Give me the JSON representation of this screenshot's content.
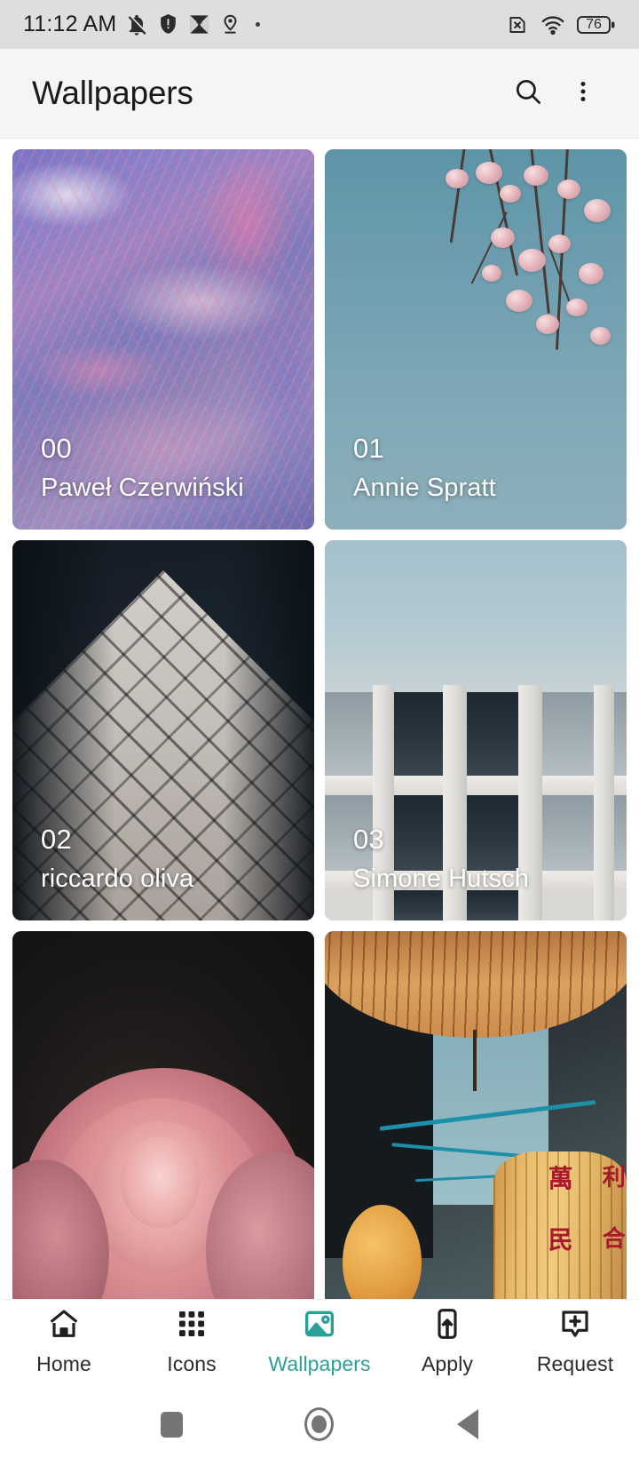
{
  "status_bar": {
    "time": "11:12 AM",
    "battery_percent": "76",
    "left_icons": [
      "notifications-muted-icon",
      "shield-warning-icon",
      "image-download-icon",
      "location-pin-icon",
      "more-dot-icon"
    ],
    "right_icons": [
      "sim-card-off-icon",
      "wifi-icon",
      "battery-icon"
    ]
  },
  "app_bar": {
    "title": "Wallpapers",
    "search_label": "search-icon",
    "overflow_label": "overflow-menu-icon"
  },
  "wallpapers": [
    {
      "number": "00",
      "author": "Paweł Czerwiński",
      "art": "marble"
    },
    {
      "number": "01",
      "author": "Annie Spratt",
      "art": "blossom"
    },
    {
      "number": "02",
      "author": "riccardo oliva",
      "art": "roof"
    },
    {
      "number": "03",
      "author": "Simone Hutsch",
      "art": "facade"
    },
    {
      "number": "",
      "author": "",
      "art": "rose"
    },
    {
      "number": "",
      "author": "",
      "art": "lantern"
    }
  ],
  "bottom_nav": {
    "active_color": "#2aa198",
    "items": [
      {
        "label": "Home",
        "icon": "home-icon",
        "active": false
      },
      {
        "label": "Icons",
        "icon": "grid-dots-icon",
        "active": false
      },
      {
        "label": "Wallpapers",
        "icon": "image-icon",
        "active": true
      },
      {
        "label": "Apply",
        "icon": "apply-phone-up-icon",
        "active": false
      },
      {
        "label": "Request",
        "icon": "request-plus-icon",
        "active": false
      }
    ]
  },
  "system_nav": {
    "recents": "recents-square-icon",
    "home": "home-circle-icon",
    "back": "back-triangle-icon"
  }
}
